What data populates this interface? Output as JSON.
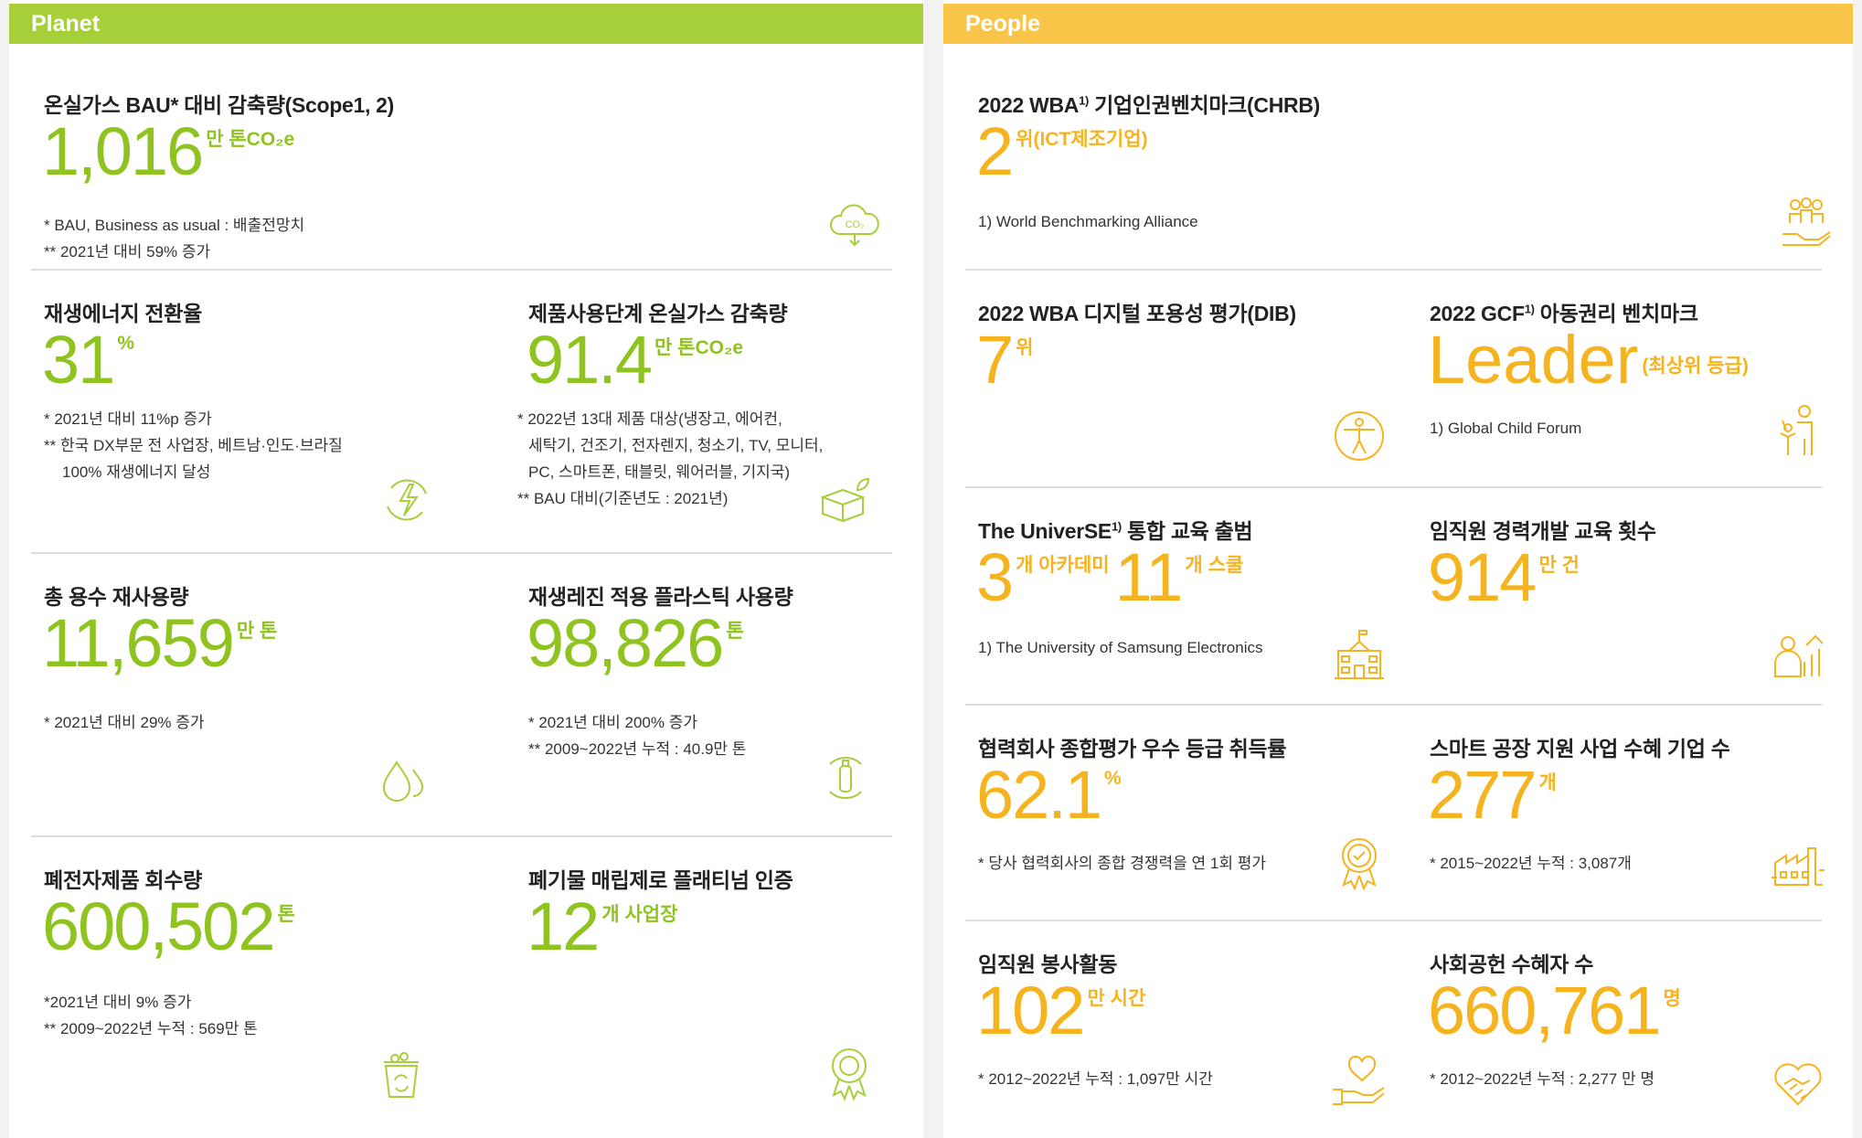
{
  "colors": {
    "planet": "#a6cf39",
    "people": "#f8c548",
    "green_text": "#8fc31f",
    "orange_text": "#f5b31f"
  },
  "planet": {
    "header": "Planet",
    "ghg": {
      "title": "온실가스 BAU* 대비 감축량(Scope1, 2)",
      "value": "1,016",
      "unit": "만 톤CO₂e",
      "notes": [
        "* BAU, Business as usual : 배출전망치",
        "** 2021년 대비 59% 증가"
      ],
      "icon": "co2-cloud-icon"
    },
    "renewable": {
      "title": "재생에너지 전환율",
      "value": "31",
      "unit": "%",
      "notes": [
        "* 2021년 대비 11%p 증가",
        "** 한국 DX부문 전 사업장, 베트남·인도·브라질",
        "100% 재생에너지 달성"
      ],
      "icon": "lightning-recycle-icon"
    },
    "product_ghg": {
      "title": "제품사용단계 온실가스 감축량",
      "value": "91.4",
      "unit": "만 톤CO₂e",
      "notes": [
        "* 2022년 13대 제품 대상(냉장고, 에어컨,",
        "세탁기, 건조기, 전자렌지, 청소기, TV, 모니터,",
        "PC, 스마트폰, 태블릿, 웨어러블, 기지국)",
        "** BAU 대비(기준년도 : 2021년)"
      ],
      "icon": "eco-box-icon"
    },
    "water": {
      "title": "총 용수 재사용량",
      "value": "11,659",
      "unit": "만 톤",
      "notes": [
        "* 2021년 대비 29% 증가"
      ],
      "icon": "water-drop-icon"
    },
    "resin": {
      "title": "재생레진 적용 플라스틱 사용량",
      "value": "98,826",
      "unit": "톤",
      "notes": [
        "* 2021년 대비 200% 증가",
        "** 2009~2022년 누적 : 40.9만 톤"
      ],
      "icon": "bottle-recycle-icon"
    },
    "ewaste": {
      "title": "폐전자제품 회수량",
      "value": "600,502",
      "unit": "톤",
      "notes": [
        "*2021년 대비 9% 증가",
        "** 2009~2022년 누적 : 569만 톤"
      ],
      "icon": "recycle-bin-icon"
    },
    "landfill": {
      "title": "폐기물 매립제로 플래티넘 인증",
      "value": "12",
      "unit": "개 사업장",
      "notes": [],
      "icon": "certificate-badge-icon"
    }
  },
  "people": {
    "header": "People",
    "wba": {
      "title": "2022 WBA",
      "sup": "1)",
      "title2": " 기업인권벤치마크(CHRB)",
      "value": "2",
      "unit": "위(ICT제조기업)",
      "notes": [
        "1) World Benchmarking Alliance"
      ],
      "icon": "people-hand-icon"
    },
    "dib": {
      "title": "2022 WBA 디지털 포용성 평가(DIB)",
      "value": "7",
      "unit": "위",
      "notes": [],
      "icon": "human-circle-icon"
    },
    "gcf": {
      "title": "2022 GCF",
      "sup": "1)",
      "title2": " 아동권리 벤치마크",
      "value": "Leader",
      "unit": "(최상위 등급)",
      "notes": [
        "1) Global Child Forum"
      ],
      "icon": "parent-child-icon"
    },
    "universe": {
      "title": "The UniverSE",
      "sup": "1)",
      "title2": " 통합 교육 출범",
      "value": "3",
      "unit": "개 아카데미",
      "value2": "11",
      "unit2": "개 스쿨",
      "notes": [
        "1) The University of Samsung Electronics"
      ],
      "icon": "school-building-icon"
    },
    "career": {
      "title": "임직원 경력개발 교육 횟수",
      "value": "914",
      "unit": "만 건",
      "notes": [],
      "icon": "career-growth-icon"
    },
    "partner": {
      "title": "협력회사 종합평가 우수 등급 취득률",
      "value": "62.1",
      "unit": "%",
      "notes": [
        "* 당사 협력회사의 종합 경쟁력을 연 1회 평가"
      ],
      "icon": "award-medal-icon"
    },
    "smart": {
      "title": "스마트 공장 지원 사업 수혜 기업 수",
      "value": "277",
      "unit": "개",
      "notes": [
        "* 2015~2022년 누적 : 3,087개"
      ],
      "icon": "factory-icon"
    },
    "volunteer": {
      "title": "임직원 봉사활동",
      "value": "102",
      "unit": "만 시간",
      "notes": [
        "* 2012~2022년 누적 : 1,097만 시간"
      ],
      "icon": "heart-hand-icon"
    },
    "beneficiary": {
      "title": "사회공헌 수혜자 수",
      "value": "660,761",
      "unit": "명",
      "notes": [
        "* 2012~2022년 누적 : 2,277 만 명"
      ],
      "icon": "heart-handshake-icon"
    }
  }
}
